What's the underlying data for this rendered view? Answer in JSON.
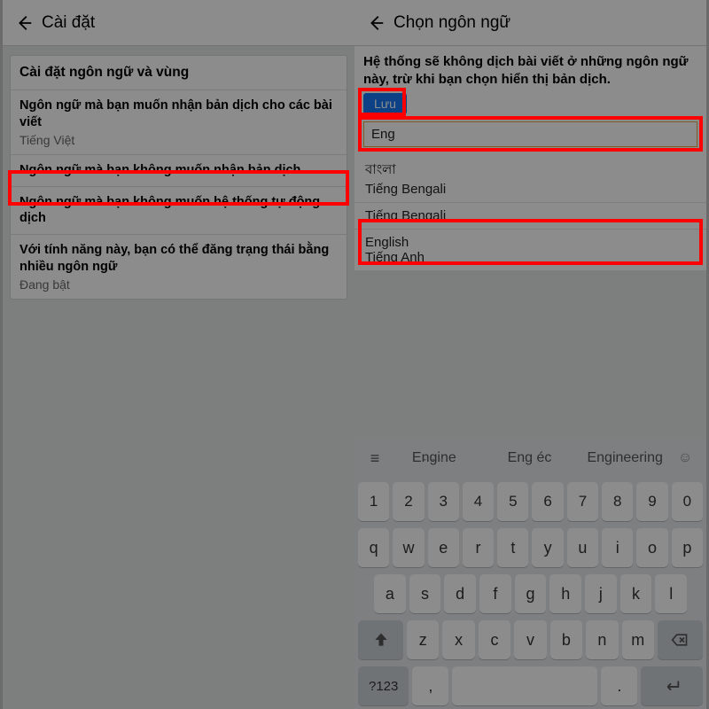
{
  "left": {
    "header_title": "Cài đặt",
    "group_title": "Cài đặt ngôn ngữ và vùng",
    "rows": [
      {
        "title": "Ngôn ngữ mà bạn muốn nhận bản dịch cho các bài viết",
        "sub": "Tiếng Việt"
      },
      {
        "title": "Ngôn ngữ mà bạn không muốn nhận bản dịch",
        "sub": ""
      },
      {
        "title": "Ngôn ngữ mà bạn không muốn hệ thống tự động dịch",
        "sub": ""
      },
      {
        "title": "Với tính năng này, bạn có thể đăng trạng thái bằng nhiều ngôn ngữ",
        "sub": "Đang bật"
      }
    ]
  },
  "right": {
    "header_title": "Chọn ngôn ngữ",
    "description": "Hệ thống sẽ không dịch bài viết ở những ngôn ngữ này, trừ khi bạn chọn hiển thị bản dịch.",
    "save_label": "Lưu",
    "search_value": "Eng",
    "languages": [
      {
        "native": "বাংলা",
        "local": "Tiếng Bengali"
      },
      {
        "native": "",
        "local": "Tiếng Bengali"
      },
      {
        "native": "English",
        "local": "Tiếng Anh"
      }
    ]
  },
  "keyboard": {
    "suggestions": [
      "Engine",
      "Eng éc",
      "Engineering"
    ],
    "row_num": [
      "1",
      "2",
      "3",
      "4",
      "5",
      "6",
      "7",
      "8",
      "9",
      "0"
    ],
    "row_q": [
      "q",
      "w",
      "e",
      "r",
      "t",
      "y",
      "u",
      "i",
      "o",
      "p"
    ],
    "row_a": [
      "a",
      "s",
      "d",
      "f",
      "g",
      "h",
      "j",
      "k",
      "l"
    ],
    "row_z": [
      "z",
      "x",
      "c",
      "v",
      "b",
      "n",
      "m"
    ],
    "sym_label": "?123",
    "comma": ",",
    "dot": "."
  }
}
